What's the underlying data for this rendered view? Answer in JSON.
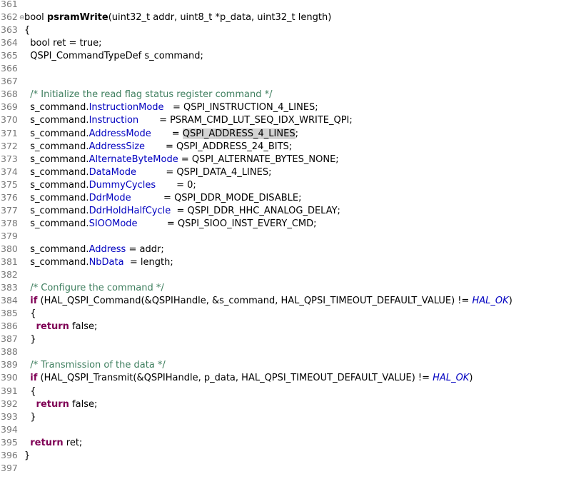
{
  "editor": {
    "lines": [
      {
        "n": "361",
        "fold": "",
        "segs": []
      },
      {
        "n": "362",
        "fold": "⊖",
        "segs": [
          {
            "t": "bool ",
            "c": ""
          },
          {
            "t": "psramWrite",
            "c": "fn"
          },
          {
            "t": "(uint32_t addr, uint8_t *p_data, uint32_t length)",
            "c": ""
          }
        ]
      },
      {
        "n": "363",
        "fold": "",
        "segs": [
          {
            "t": "{",
            "c": ""
          }
        ]
      },
      {
        "n": "364",
        "fold": "",
        "segs": [
          {
            "t": "  bool ret = true;",
            "c": ""
          }
        ]
      },
      {
        "n": "365",
        "fold": "",
        "segs": [
          {
            "t": "  QSPI_CommandTypeDef s_command;",
            "c": ""
          }
        ]
      },
      {
        "n": "366",
        "fold": "",
        "segs": []
      },
      {
        "n": "367",
        "fold": "",
        "segs": []
      },
      {
        "n": "368",
        "fold": "",
        "segs": [
          {
            "t": "  ",
            "c": ""
          },
          {
            "t": "/* Initialize the read flag status register command */",
            "c": "cm"
          }
        ]
      },
      {
        "n": "369",
        "fold": "",
        "segs": [
          {
            "t": "  s_command.",
            "c": ""
          },
          {
            "t": "InstructionMode",
            "c": "fld"
          },
          {
            "t": "   = QSPI_INSTRUCTION_4_LINES;",
            "c": ""
          }
        ]
      },
      {
        "n": "370",
        "fold": "",
        "segs": [
          {
            "t": "  s_command.",
            "c": ""
          },
          {
            "t": "Instruction",
            "c": "fld"
          },
          {
            "t": "       = PSRAM_CMD_LUT_SEQ_IDX_WRITE_QPI;",
            "c": ""
          }
        ]
      },
      {
        "n": "371",
        "fold": "",
        "segs": [
          {
            "t": "  s_command.",
            "c": ""
          },
          {
            "t": "AddressMode",
            "c": "fld"
          },
          {
            "t": "       = ",
            "c": ""
          },
          {
            "t": "QSPI_ADDRESS_4_LINES",
            "c": "hl"
          },
          {
            "t": ";",
            "c": ""
          }
        ]
      },
      {
        "n": "372",
        "fold": "",
        "segs": [
          {
            "t": "  s_command.",
            "c": ""
          },
          {
            "t": "AddressSize",
            "c": "fld"
          },
          {
            "t": "       = QSPI_ADDRESS_24_BITS;",
            "c": ""
          }
        ]
      },
      {
        "n": "373",
        "fold": "",
        "segs": [
          {
            "t": "  s_command.",
            "c": ""
          },
          {
            "t": "AlternateByteMode",
            "c": "fld"
          },
          {
            "t": " = QSPI_ALTERNATE_BYTES_NONE;",
            "c": ""
          }
        ]
      },
      {
        "n": "374",
        "fold": "",
        "segs": [
          {
            "t": "  s_command.",
            "c": ""
          },
          {
            "t": "DataMode",
            "c": "fld"
          },
          {
            "t": "          = QSPI_DATA_4_LINES;",
            "c": ""
          }
        ]
      },
      {
        "n": "375",
        "fold": "",
        "segs": [
          {
            "t": "  s_command.",
            "c": ""
          },
          {
            "t": "DummyCycles",
            "c": "fld"
          },
          {
            "t": "       = 0;",
            "c": ""
          }
        ]
      },
      {
        "n": "376",
        "fold": "",
        "segs": [
          {
            "t": "  s_command.",
            "c": ""
          },
          {
            "t": "DdrMode",
            "c": "fld"
          },
          {
            "t": "           = QSPI_DDR_MODE_DISABLE;",
            "c": ""
          }
        ]
      },
      {
        "n": "377",
        "fold": "",
        "segs": [
          {
            "t": "  s_command.",
            "c": ""
          },
          {
            "t": "DdrHoldHalfCycle",
            "c": "fld"
          },
          {
            "t": "  = QSPI_DDR_HHC_ANALOG_DELAY;",
            "c": ""
          }
        ]
      },
      {
        "n": "378",
        "fold": "",
        "segs": [
          {
            "t": "  s_command.",
            "c": ""
          },
          {
            "t": "SIOOMode",
            "c": "fld"
          },
          {
            "t": "          = QSPI_SIOO_INST_EVERY_CMD;",
            "c": ""
          }
        ]
      },
      {
        "n": "379",
        "fold": "",
        "segs": []
      },
      {
        "n": "380",
        "fold": "",
        "segs": [
          {
            "t": "  s_command.",
            "c": ""
          },
          {
            "t": "Address",
            "c": "fld"
          },
          {
            "t": " = addr;",
            "c": ""
          }
        ]
      },
      {
        "n": "381",
        "fold": "",
        "segs": [
          {
            "t": "  s_command.",
            "c": ""
          },
          {
            "t": "NbData",
            "c": "fld"
          },
          {
            "t": "  = length;",
            "c": ""
          }
        ]
      },
      {
        "n": "382",
        "fold": "",
        "segs": []
      },
      {
        "n": "383",
        "fold": "",
        "segs": [
          {
            "t": "  ",
            "c": ""
          },
          {
            "t": "/* Configure the command */",
            "c": "cm"
          }
        ]
      },
      {
        "n": "384",
        "fold": "",
        "segs": [
          {
            "t": "  ",
            "c": ""
          },
          {
            "t": "if",
            "c": "kw"
          },
          {
            "t": " (HAL_QSPI_Command(&QSPIHandle, &s_command, HAL_QPSI_TIMEOUT_DEFAULT_VALUE) != ",
            "c": ""
          },
          {
            "t": "HAL_OK",
            "c": "mac"
          },
          {
            "t": ")",
            "c": ""
          }
        ]
      },
      {
        "n": "385",
        "fold": "",
        "segs": [
          {
            "t": "  {",
            "c": ""
          }
        ]
      },
      {
        "n": "386",
        "fold": "",
        "segs": [
          {
            "t": "    ",
            "c": ""
          },
          {
            "t": "return",
            "c": "kw"
          },
          {
            "t": " false;",
            "c": ""
          }
        ]
      },
      {
        "n": "387",
        "fold": "",
        "segs": [
          {
            "t": "  }",
            "c": ""
          }
        ]
      },
      {
        "n": "388",
        "fold": "",
        "segs": []
      },
      {
        "n": "389",
        "fold": "",
        "segs": [
          {
            "t": "  ",
            "c": ""
          },
          {
            "t": "/* Transmission of the data */",
            "c": "cm"
          }
        ]
      },
      {
        "n": "390",
        "fold": "",
        "segs": [
          {
            "t": "  ",
            "c": ""
          },
          {
            "t": "if",
            "c": "kw"
          },
          {
            "t": " (HAL_QSPI_Transmit(&QSPIHandle, p_data, HAL_QPSI_TIMEOUT_DEFAULT_VALUE) != ",
            "c": ""
          },
          {
            "t": "HAL_OK",
            "c": "mac"
          },
          {
            "t": ")",
            "c": ""
          }
        ]
      },
      {
        "n": "391",
        "fold": "",
        "segs": [
          {
            "t": "  {",
            "c": ""
          }
        ]
      },
      {
        "n": "392",
        "fold": "",
        "segs": [
          {
            "t": "    ",
            "c": ""
          },
          {
            "t": "return",
            "c": "kw"
          },
          {
            "t": " false;",
            "c": ""
          }
        ]
      },
      {
        "n": "393",
        "fold": "",
        "segs": [
          {
            "t": "  }",
            "c": ""
          }
        ]
      },
      {
        "n": "394",
        "fold": "",
        "segs": []
      },
      {
        "n": "395",
        "fold": "",
        "segs": [
          {
            "t": "  ",
            "c": ""
          },
          {
            "t": "return",
            "c": "kw"
          },
          {
            "t": " ret;",
            "c": ""
          }
        ]
      },
      {
        "n": "396",
        "fold": "",
        "segs": [
          {
            "t": "}",
            "c": ""
          }
        ]
      },
      {
        "n": "397",
        "fold": "",
        "segs": []
      }
    ]
  },
  "colors": {
    "keyword": "#7f0055",
    "comment": "#3f7f5f",
    "field": "#0000c0",
    "macro": "#0000c0",
    "highlight": "#d4d4d4",
    "line_number": "#787878"
  }
}
